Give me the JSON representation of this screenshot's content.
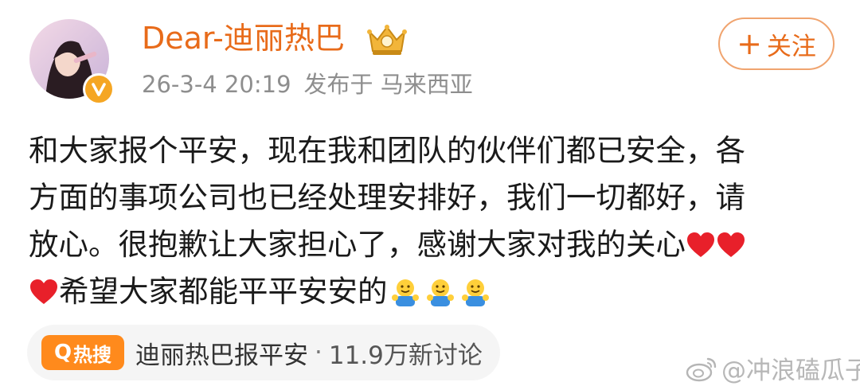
{
  "post": {
    "author": "Dear-迪丽热巴",
    "date": "26-3-4 20:19",
    "location": "发布于 马来西亚",
    "follow_label": "关注",
    "follow_plus": "+",
    "content_lines": [
      "和大家报个平安，现在我和团队的伙伴们都已安全，各",
      "方面的事项公司也已经处理安排好，我们一切都好，请",
      "放心。很抱歉让大家担心了，感谢大家对我的关心",
      "希望大家都能平平安安的"
    ]
  },
  "hot_search": {
    "badge": "热搜",
    "badge_prefix": "Q",
    "topic": "迪丽热巴报平安",
    "separator": "·",
    "discussion": "11.9万新讨论"
  },
  "watermark": {
    "text": "@冲浪磕瓜子"
  },
  "icons": {
    "verified": "verified-badge-icon",
    "crown": "crown-vip-icon",
    "heart": "red-heart-emoji",
    "hug": "hug-emoji"
  },
  "colors": {
    "username": "#e86b1a",
    "follow_border": "#f0a46f",
    "hot_badge": "#ff8a1c",
    "heart": "#e8202a",
    "meta": "#8e8e8e"
  }
}
